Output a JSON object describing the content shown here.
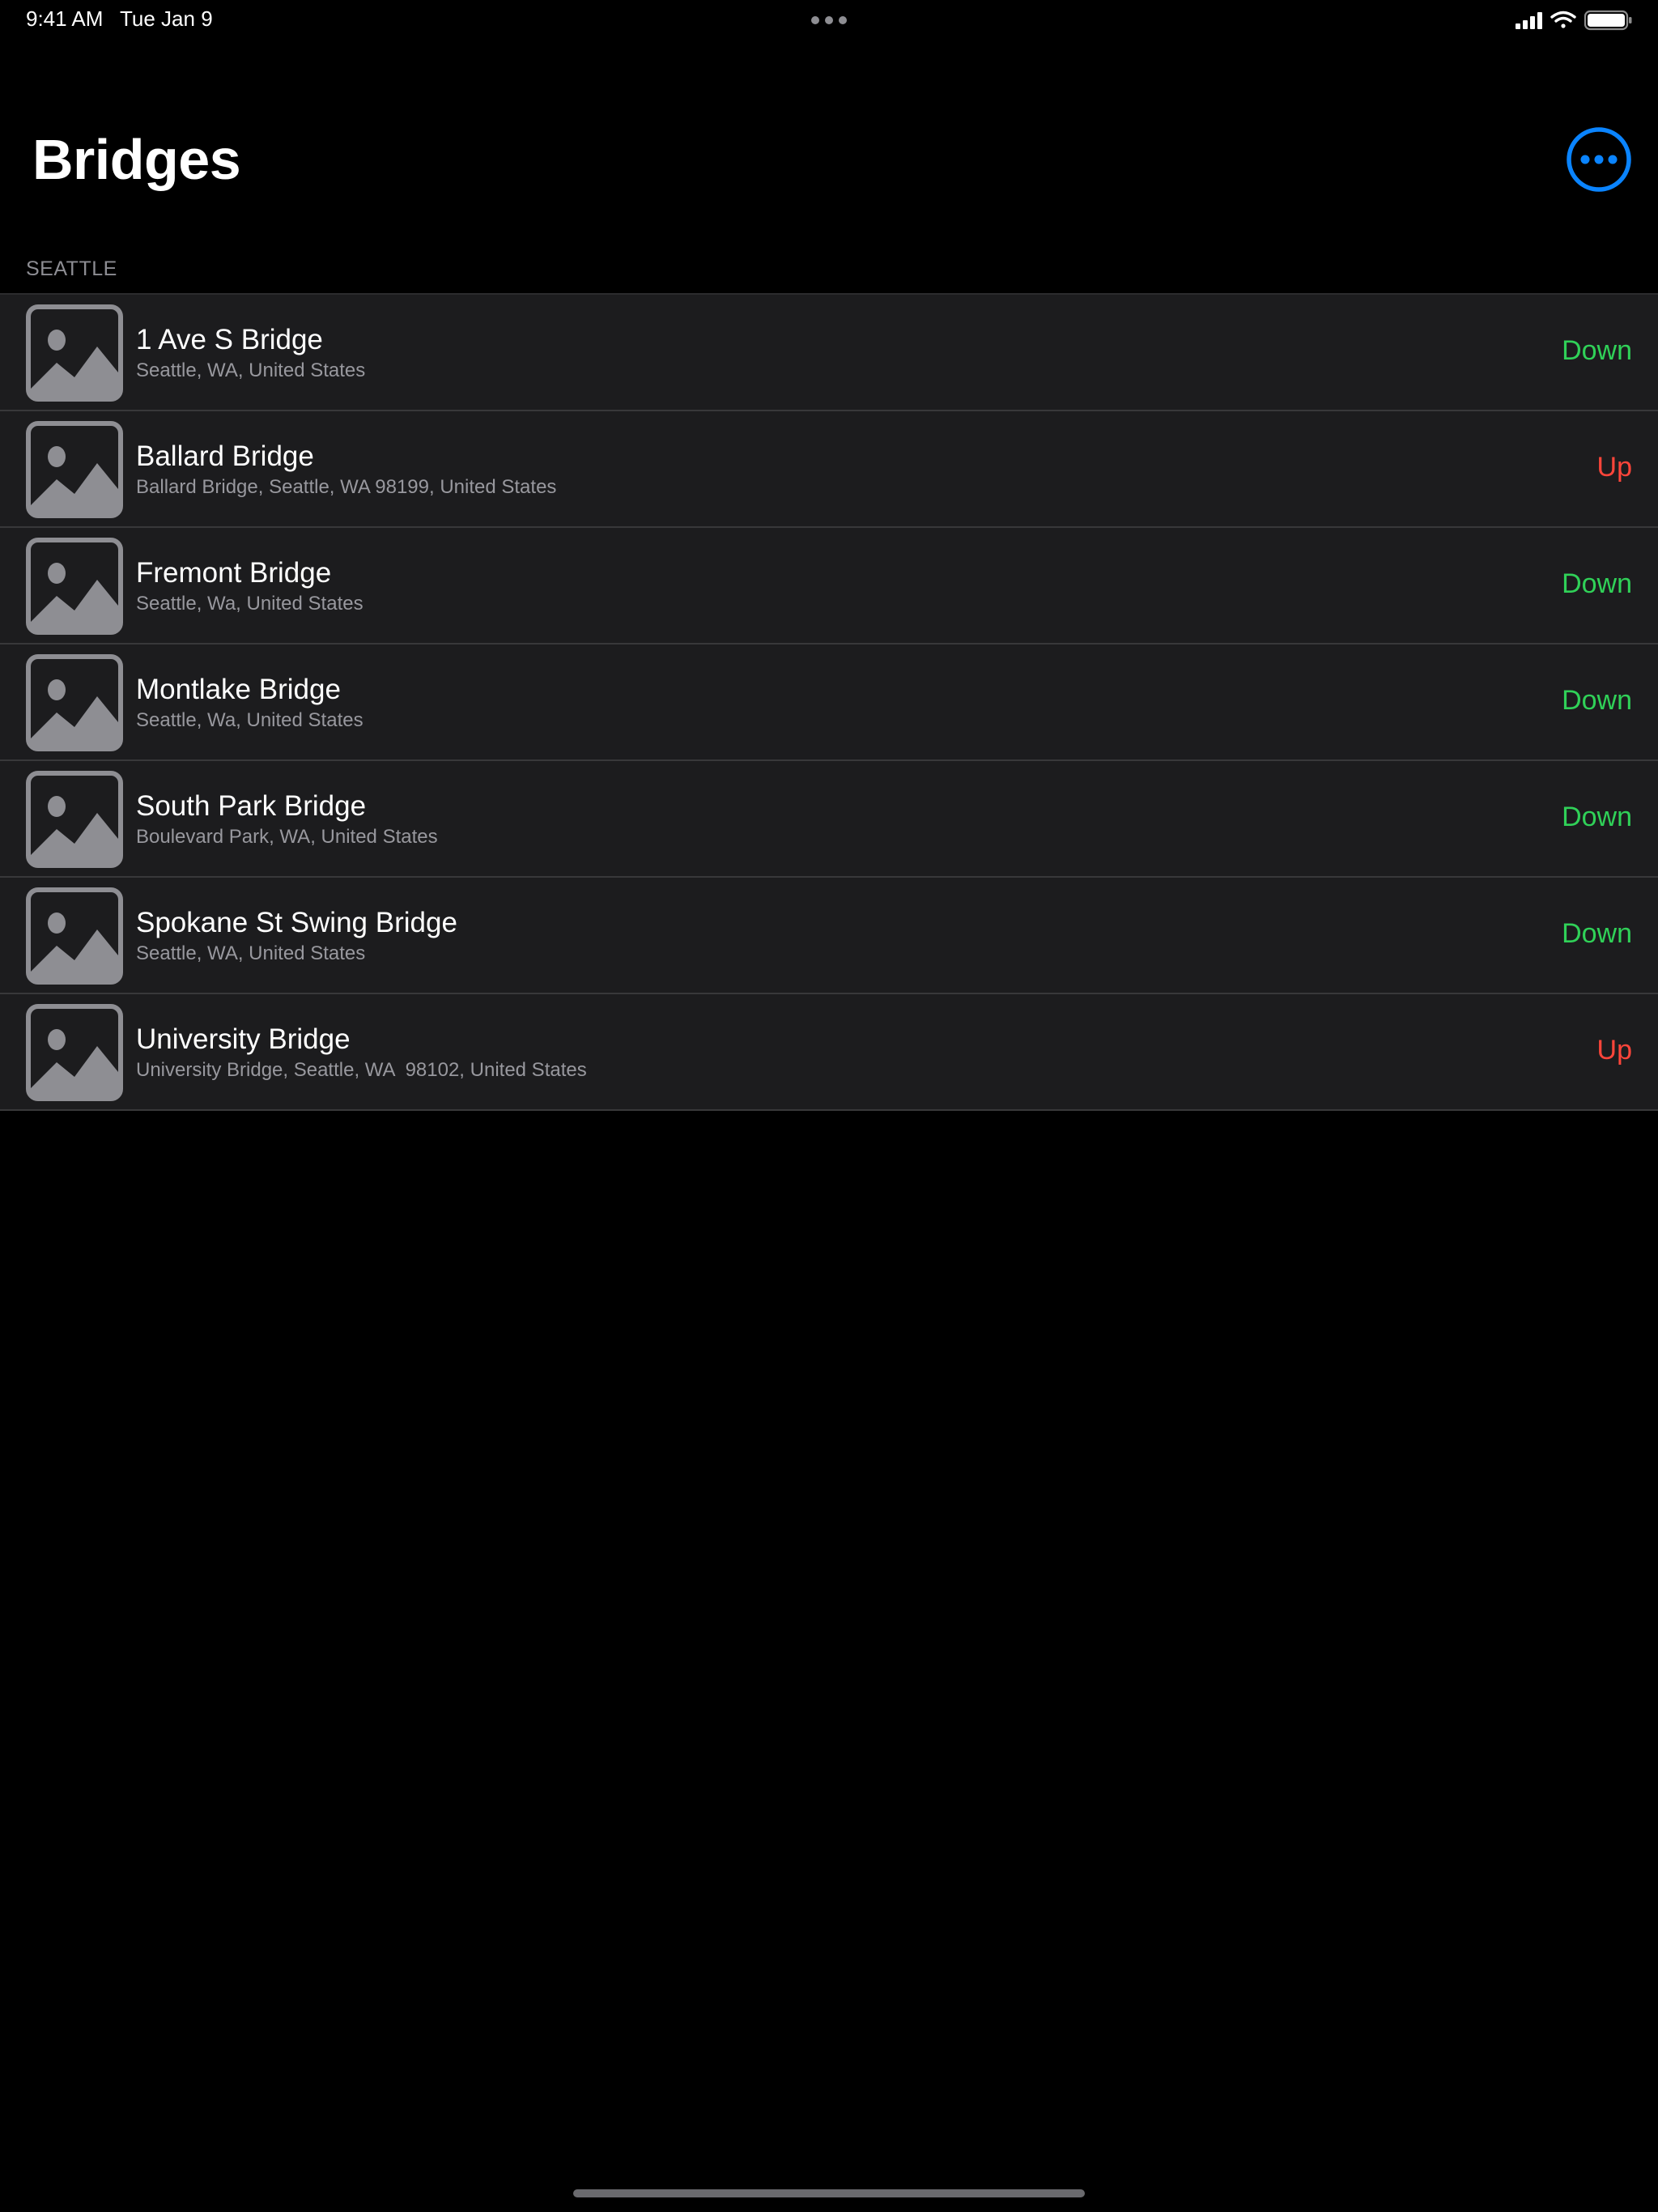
{
  "status_bar": {
    "time": "9:41 AM",
    "date": "Tue Jan 9",
    "icons": [
      "cellular-signal-icon",
      "wifi-icon",
      "battery-icon"
    ]
  },
  "header": {
    "title": "Bridges",
    "more_icon": "ellipsis-circle-icon"
  },
  "section": {
    "title": "SEATTLE"
  },
  "colors": {
    "down": "#30d158",
    "up": "#ff453a",
    "accent": "#0a84ff"
  },
  "bridges": [
    {
      "name": "1 Ave S Bridge",
      "address": "Seattle, WA, United States",
      "status": "Down",
      "thumbnail": "photo-placeholder-icon"
    },
    {
      "name": "Ballard Bridge",
      "address": "Ballard Bridge, Seattle, WA 98199, United States",
      "status": "Up",
      "thumbnail": "photo-placeholder-icon"
    },
    {
      "name": "Fremont Bridge",
      "address": "Seattle, Wa, United States",
      "status": "Down",
      "thumbnail": "photo-placeholder-icon"
    },
    {
      "name": "Montlake Bridge",
      "address": "Seattle, Wa, United States",
      "status": "Down",
      "thumbnail": "photo-placeholder-icon"
    },
    {
      "name": "South Park Bridge",
      "address": "Boulevard Park, WA, United States",
      "status": "Down",
      "thumbnail": "photo-placeholder-icon"
    },
    {
      "name": "Spokane St Swing Bridge",
      "address": "Seattle, WA, United States",
      "status": "Down",
      "thumbnail": "photo-placeholder-icon"
    },
    {
      "name": "University Bridge",
      "address": "University Bridge, Seattle, WA  98102, United States",
      "status": "Up",
      "thumbnail": "photo-placeholder-icon"
    }
  ]
}
